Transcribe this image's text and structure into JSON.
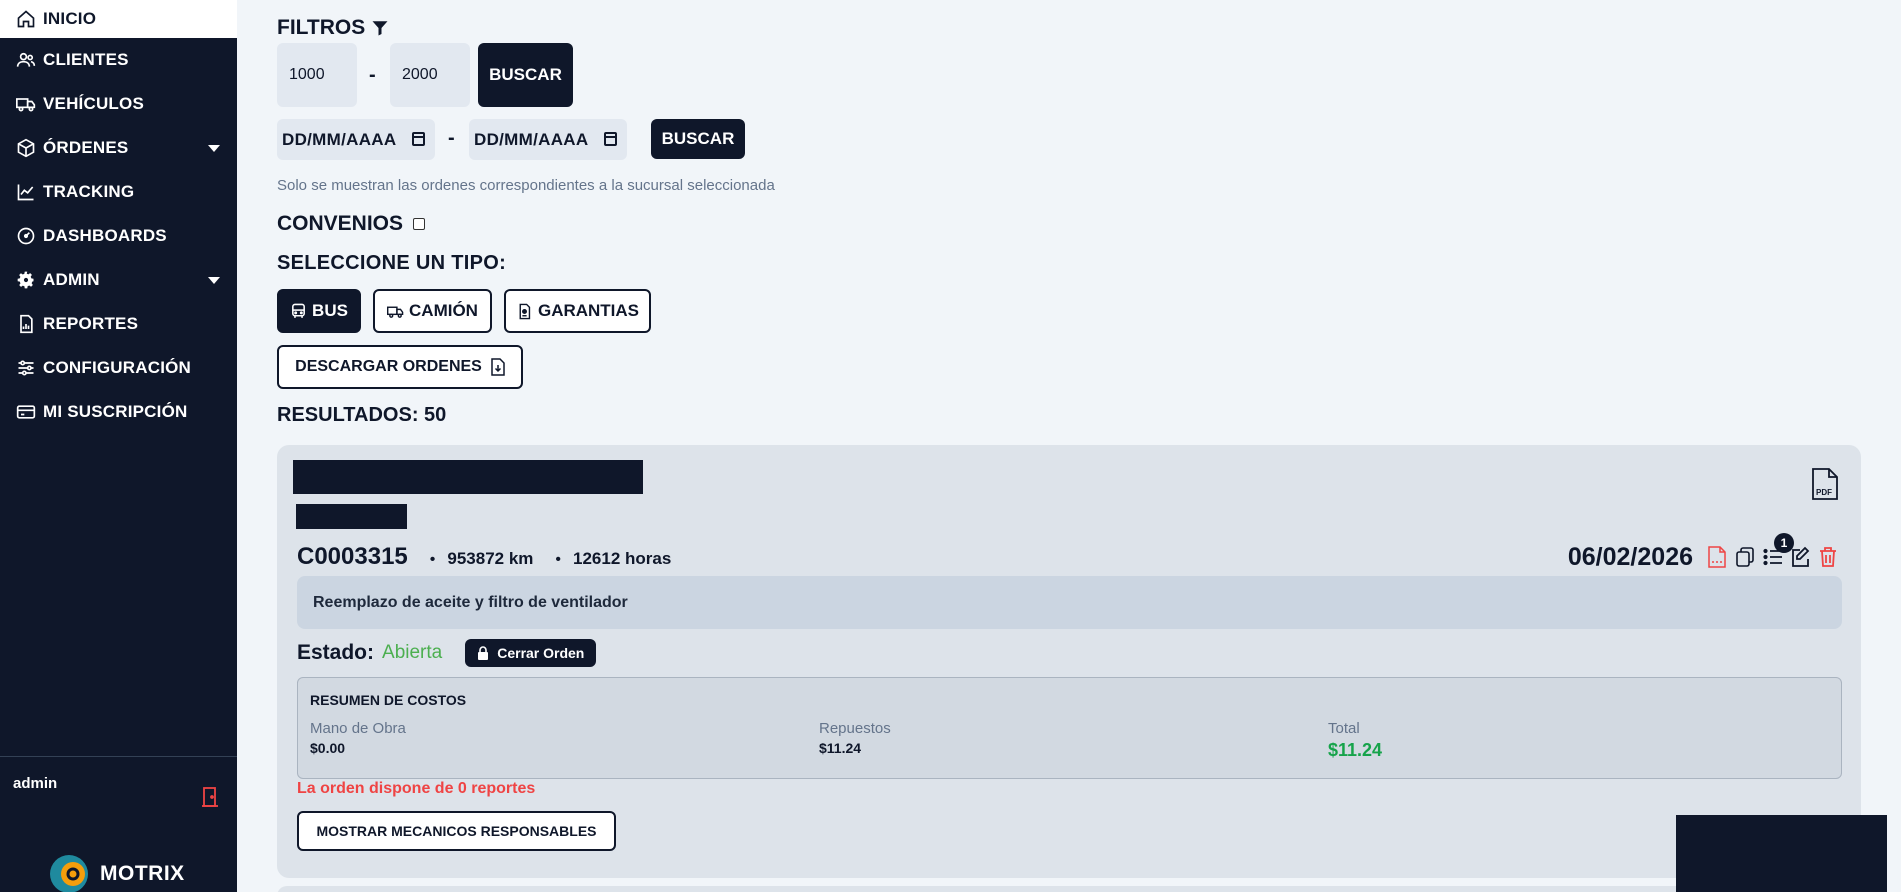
{
  "sidebar": {
    "items": [
      {
        "label": "INICIO",
        "icon": "home-icon"
      },
      {
        "label": "CLIENTES",
        "icon": "users-icon"
      },
      {
        "label": "VEHÍCULOS",
        "icon": "truck-icon"
      },
      {
        "label": "ÓRDENES",
        "icon": "box-icon"
      },
      {
        "label": "TRACKING",
        "icon": "chart-line-icon"
      },
      {
        "label": "DASHBOARDS",
        "icon": "gauge-icon"
      },
      {
        "label": "ADMIN",
        "icon": "gear-icon"
      },
      {
        "label": "REPORTES",
        "icon": "report-icon"
      },
      {
        "label": "CONFIGURACIÓN",
        "icon": "sliders-icon"
      },
      {
        "label": "MI SUSCRIPCIÓN",
        "icon": "credit-card-icon"
      }
    ],
    "user": "admin",
    "brand": "MOTRIX"
  },
  "filters": {
    "title": "FILTROS",
    "range_from": "1000",
    "range_to": "2000",
    "range_sep": "-",
    "search_label": "BUSCAR",
    "date_from_placeholder": "DD/MM/AAAA",
    "date_to_placeholder": "DD/MM/AAAA",
    "date_sep": "-",
    "search_label_2": "BUSCAR",
    "note": "Solo se muestran las ordenes correspondientes a la sucursal seleccionada",
    "convenios_label": "CONVENIOS"
  },
  "types": {
    "title": "SELECCIONE UN TIPO:",
    "bus": "BUS",
    "camion": "CAMIÓN",
    "garantias": "GARANTIAS",
    "download": "DESCARGAR ORDENES"
  },
  "results": {
    "label": "RESULTADOS: 50"
  },
  "order": {
    "code": "C0003315",
    "km": "953872 km",
    "hours": "12612 horas",
    "date": "06/02/2026",
    "pdf_label": "PDF",
    "badge_count": "1",
    "description": "Reemplazo de aceite y filtro de ventilador",
    "estado_label": "Estado:",
    "estado_value": "Abierta",
    "close_label": "Cerrar Orden",
    "costs": {
      "title": "RESUMEN DE COSTOS",
      "labor_label": "Mano de Obra",
      "labor_value": "$0.00",
      "parts_label": "Repuestos",
      "parts_value": "$11.24",
      "total_label": "Total",
      "total_value": "$11.24"
    },
    "reports_text": "La orden dispone de 0 reportes",
    "mechanics_label": "MOSTRAR MECANICOS RESPONSABLES"
  },
  "colors": {
    "navy": "#0f172a",
    "status_green": "#4caf50",
    "total_green": "#16a34a",
    "alert_red": "#ef4444",
    "logo_teal": "#1f8a9e",
    "logo_orange": "#f59e0b"
  }
}
